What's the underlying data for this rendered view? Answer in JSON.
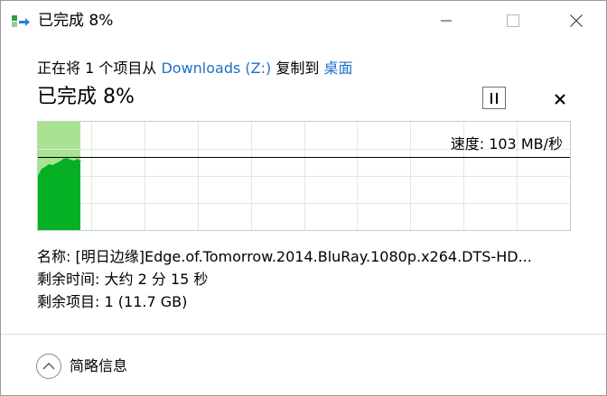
{
  "window": {
    "title": "已完成 8%",
    "icon": "copy-arrow-icon",
    "controls": [
      "minimize-icon",
      "maximize-icon",
      "close-icon"
    ]
  },
  "copy_line": {
    "prefix": "正在将 1 个项目从 ",
    "source": "Downloads (Z:)",
    "middle": " 复制到 ",
    "destination": "桌面"
  },
  "status": {
    "heading": "已完成 8%",
    "progress_fraction": 0.08,
    "pause_label": "II",
    "cancel_label": "✕"
  },
  "graph": {
    "speed_text": "速度: 103 MB/秒",
    "colors": {
      "fill_done": "#a8e292",
      "area": "#06b025",
      "grid": "#d7efd7",
      "speed_line": "#000000"
    }
  },
  "info": {
    "name_label": "名称:",
    "name_value": "[明日边缘]Edge.of.Tomorrow.2014.BluRay.1080p.x264.DTS-HD...",
    "time_label": "剩余时间:",
    "time_value": "大约 2 分 15 秒",
    "items_label": "剩余项目:",
    "items_value": "1 (11.7 GB)"
  },
  "footer": {
    "toggle_label": "简略信息"
  }
}
